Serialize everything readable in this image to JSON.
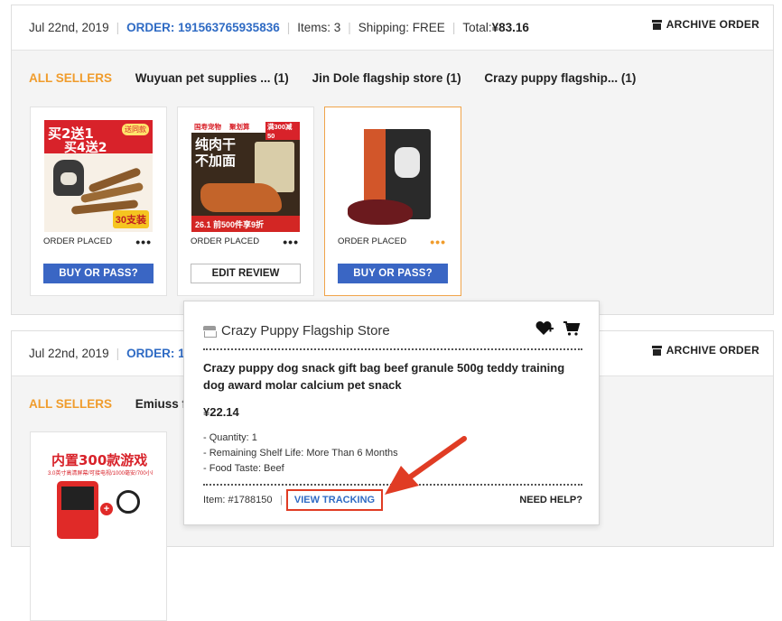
{
  "orders": [
    {
      "date": "Jul 22nd, 2019",
      "order_label": "ORDER: 191563765935836",
      "items": "Items: 3",
      "shipping": "Shipping: FREE",
      "total_label": "Total: ",
      "total_value": "¥83.16",
      "archive_label": "ARCHIVE ORDER",
      "all_sellers": "ALL SELLERS",
      "sellers": [
        "Wuyuan pet supplies ...  (1)",
        "Jin Dole flagship store  (1)",
        "Crazy puppy flagship...  (1)"
      ],
      "products": [
        {
          "status": "ORDER PLACED",
          "button": "BUY OR PASS?",
          "img_text_1": "买2送1",
          "img_text_2": "买4送2",
          "img_badge": "送同款",
          "img_count": "30支装"
        },
        {
          "status": "ORDER PLACED",
          "button": "EDIT REVIEW",
          "img_text_1": "纯肉干",
          "img_text_2": "不加面",
          "img_bottom": "26.1 前500件享9折",
          "img_top_left": "国寿宠物",
          "img_top_mid": "聚划算",
          "img_top_right": "满300减50"
        },
        {
          "status": "ORDER PLACED",
          "button": "BUY OR PASS?"
        }
      ]
    },
    {
      "date": "Jul 22nd, 2019",
      "order_label": "ORDER: 1",
      "archive_label": "ARCHIVE ORDER",
      "all_sellers": "ALL SELLERS",
      "sellers": [
        "Emiuss flo"
      ],
      "products": [
        {
          "img_title": "内置300款游戏",
          "img_sub": "3.0英寸高清屏幕/可接电视/1000毫安/700小时续航"
        }
      ]
    }
  ],
  "popup": {
    "store_name": "Crazy Puppy Flagship Store",
    "product_title": "Crazy puppy dog snack gift bag beef granule 500g teddy training dog award molar calcium pet snack",
    "price": "¥22.14",
    "attributes": [
      "- Quantity: 1",
      "- Remaining Shelf Life: More Than 6 Months",
      "- Food Taste: Beef"
    ],
    "item_number": "Item: #1788150",
    "separator": "|",
    "view_tracking": "VIEW TRACKING",
    "need_help": "NEED HELP?"
  },
  "colors": {
    "accent_orange": "#f09c2c",
    "link_blue": "#2f6bc4",
    "button_blue": "#3a66c4",
    "annotation_red": "#e03c24"
  }
}
